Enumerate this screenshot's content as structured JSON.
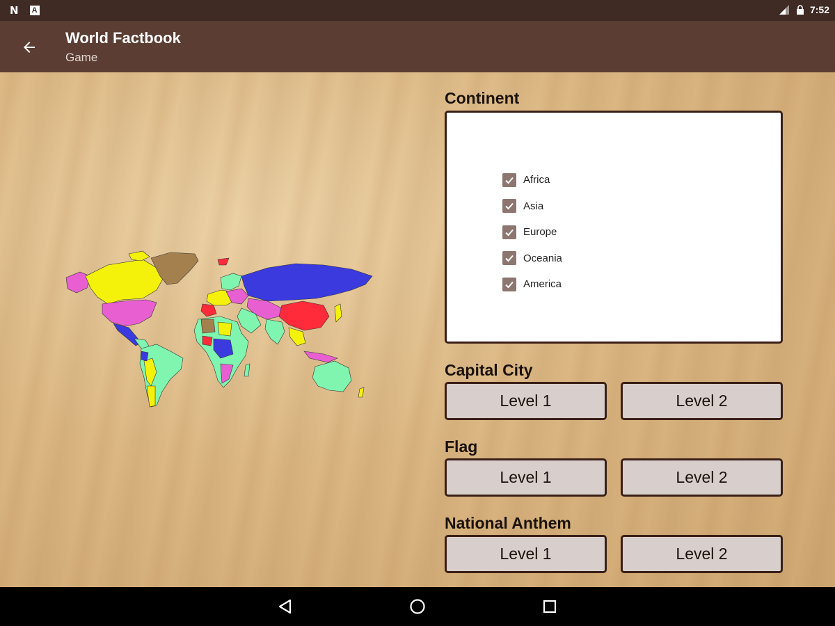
{
  "status_bar": {
    "left_icons": [
      "N",
      "A"
    ],
    "time": "7:52"
  },
  "app_bar": {
    "title": "World Factbook",
    "subtitle": "Game"
  },
  "continent": {
    "label": "Continent",
    "options": [
      {
        "label": "Africa",
        "checked": true
      },
      {
        "label": "Asia",
        "checked": true
      },
      {
        "label": "Europe",
        "checked": true
      },
      {
        "label": "Oceania",
        "checked": true
      },
      {
        "label": "America",
        "checked": true
      }
    ]
  },
  "sections": [
    {
      "label": "Capital City",
      "buttons": [
        "Level 1",
        "Level 2"
      ]
    },
    {
      "label": "Flag",
      "buttons": [
        "Level 1",
        "Level 2"
      ]
    },
    {
      "label": "National Anthem",
      "buttons": [
        "Level 1",
        "Level 2"
      ]
    }
  ],
  "colors": {
    "status_bar": "#3f2a24",
    "app_bar": "#5b3d33",
    "button_fill": "#d8cfcc",
    "button_border": "#3a1f17",
    "checkbox": "#8d766f"
  },
  "icons": {
    "back": "arrow-left-icon",
    "nav": [
      "back-triangle-icon",
      "home-circle-icon",
      "recents-square-icon"
    ]
  }
}
